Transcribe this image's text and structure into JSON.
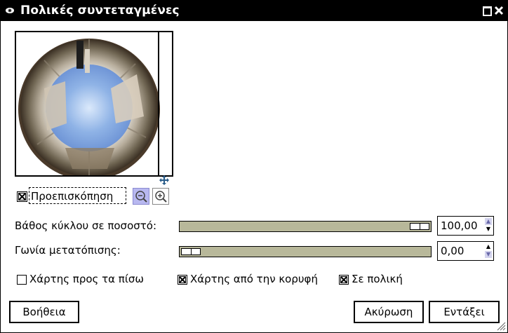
{
  "window": {
    "title": "Πολικές συντεταγμένες",
    "icons": {
      "app": "eye-icon",
      "maximize": "maximize-icon",
      "close": "close-icon"
    }
  },
  "preview": {
    "image_description": "",
    "checkbox_label": "Προεπισκόπηση",
    "checked": true,
    "icons": {
      "move": "move-icon",
      "zoom_out": "zoom-out-icon",
      "zoom_in": "zoom-in-icon"
    }
  },
  "controls": {
    "circle_depth": {
      "label": "Βάθος κύκλου σε ποσοστό:",
      "value": "100,00",
      "fraction": 1.0
    },
    "offset_angle": {
      "label": "Γωνία μετατόπισης:",
      "value": "0,00",
      "fraction": 0.0
    }
  },
  "options": [
    {
      "label": "Χάρτης προς τα πίσω",
      "checked": false
    },
    {
      "label": "Χάρτης από την κορυφή",
      "checked": true
    },
    {
      "label": "Σε πολική",
      "checked": true
    }
  ],
  "buttons": {
    "help": "Βοήθεια",
    "cancel": "Ακύρωση",
    "ok": "Εντάξει"
  }
}
